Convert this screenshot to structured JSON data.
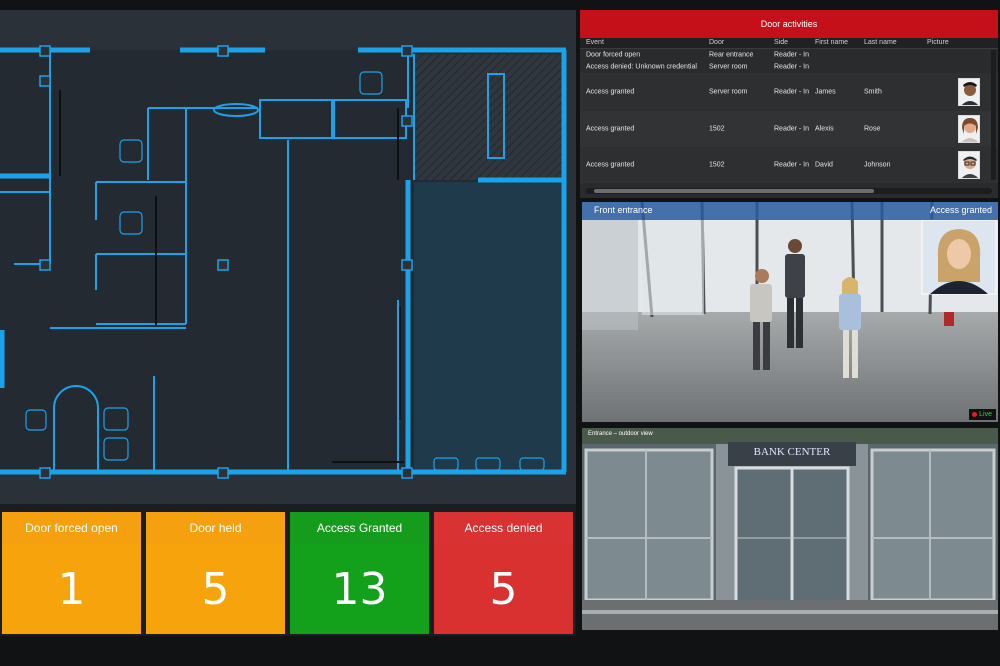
{
  "counters": [
    {
      "label": "Door forced open",
      "value": "1",
      "header_color": "#f5a00f",
      "body_color": "#f7a30c"
    },
    {
      "label": "Door held",
      "value": "5",
      "header_color": "#f5a00f",
      "body_color": "#f7a30c"
    },
    {
      "label": "Access Granted",
      "value": "13",
      "header_color": "#169c1c",
      "body_color": "#13a01b"
    },
    {
      "label": "Access denied",
      "value": "5",
      "header_color": "#d83232",
      "body_color": "#d93030"
    }
  ],
  "activities": {
    "title": "Door activities",
    "columns": [
      "Event",
      "Door",
      "Side",
      "First name",
      "Last name",
      "Picture"
    ],
    "rows": [
      {
        "event": "Door forced open",
        "door": "Rear entrance",
        "side": "Reader - In",
        "first": "",
        "last": "",
        "picture": ""
      },
      {
        "event": "Access denied: Unknown credential",
        "door": "Server room",
        "side": "Reader - In",
        "first": "",
        "last": "",
        "picture": ""
      },
      {
        "event": "Access granted",
        "door": "Server room",
        "side": "Reader - In",
        "first": "James",
        "last": "Smith",
        "picture": "person-thumbnail-icon"
      },
      {
        "event": "Access granted",
        "door": "1502",
        "side": "Reader - In",
        "first": "Alexis",
        "last": "Rose",
        "picture": "person-thumbnail-icon"
      },
      {
        "event": "Access granted",
        "door": "1502",
        "side": "Reader - In",
        "first": "David",
        "last": "Johnson",
        "picture": "person-thumbnail-icon"
      }
    ]
  },
  "cameras": [
    {
      "title": "Front entrance",
      "status": "Access granted",
      "badge": "Live"
    },
    {
      "title": "Entrance – outdoor view",
      "sign": "BANK CENTER"
    }
  ],
  "colors": {
    "plan_line": "#1aa3e8",
    "alert_red": "#c5101a",
    "bar_blue": "#2f64a8"
  }
}
